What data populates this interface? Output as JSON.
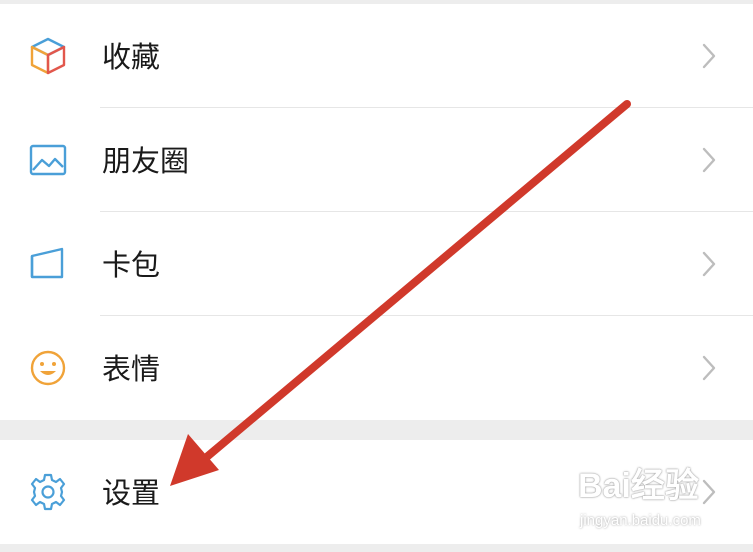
{
  "menu": {
    "items": [
      {
        "label": "收藏",
        "icon": "favorites-cube-icon"
      },
      {
        "label": "朋友圈",
        "icon": "moments-picture-icon"
      },
      {
        "label": "卡包",
        "icon": "card-wallet-icon"
      },
      {
        "label": "表情",
        "icon": "sticker-smiley-icon"
      }
    ],
    "settings": {
      "label": "设置",
      "icon": "settings-gear-icon"
    }
  },
  "annotation": {
    "arrow_color": "#d0392b"
  },
  "watermark": {
    "brand": "Bai经验",
    "url": "jingyan.baidu.com"
  },
  "colors": {
    "background": "#ededed",
    "row": "#ffffff",
    "text": "#1a1a1a",
    "icon_blue": "#4a9fd8",
    "smiley_orange": "#f0a339"
  }
}
